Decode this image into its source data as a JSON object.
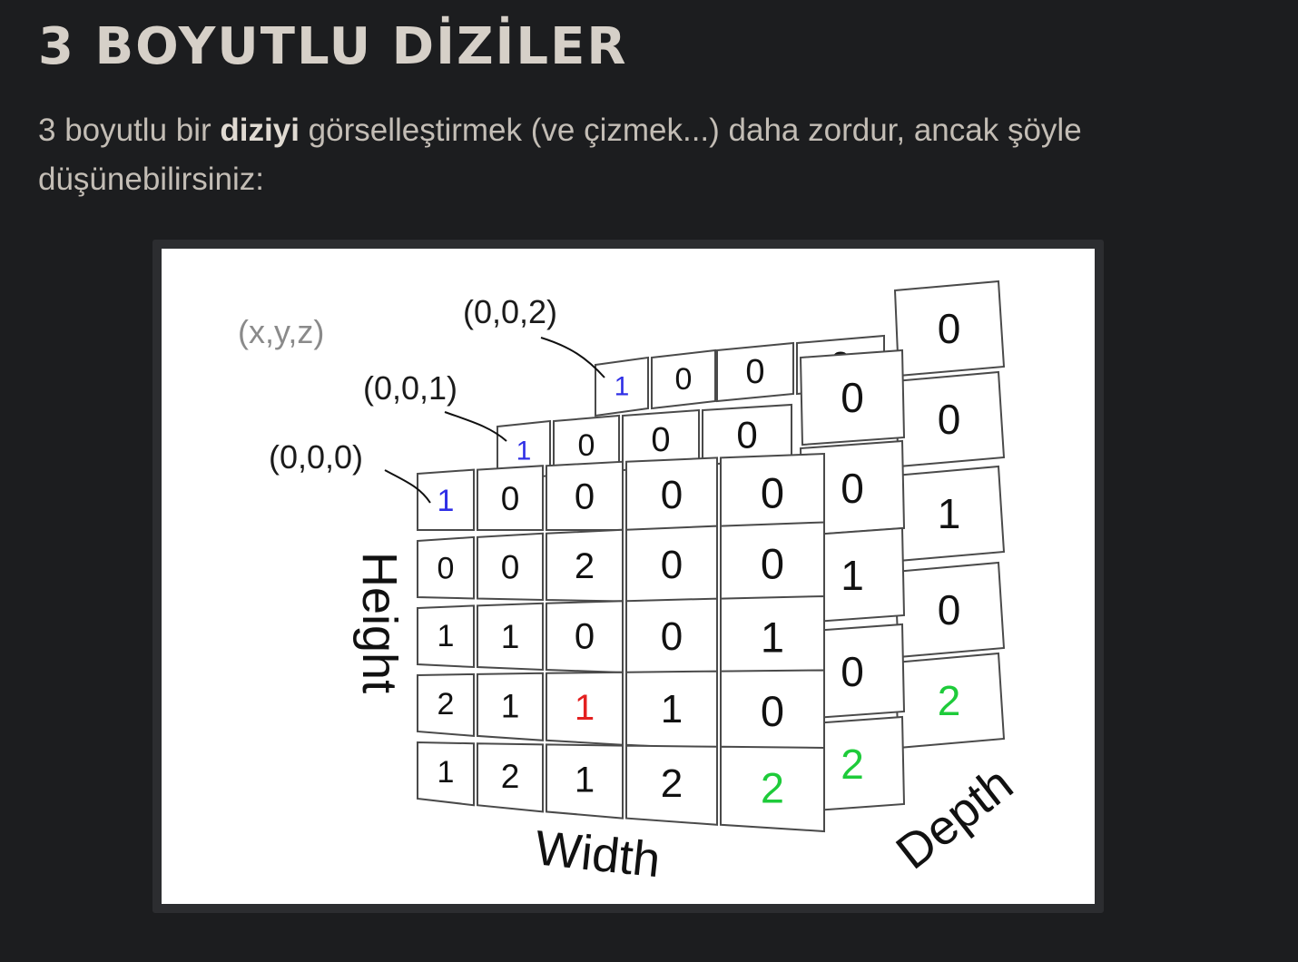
{
  "title": "3 BOYUTLU DİZİLER",
  "intro": {
    "before": "3 boyutlu bir ",
    "bold": "diziyi",
    "after": " görselleştirmek (ve çizmek...) daha zordur, ancak şöyle düşünebilirsiniz:"
  },
  "figure": {
    "legend": "(x,y,z)",
    "coord_labels": [
      "(0,0,0)",
      "(0,0,1)",
      "(0,0,2)"
    ],
    "axes": {
      "height": "Height",
      "width": "Width",
      "depth": "Depth"
    },
    "value_colors": {
      "default": "#111111",
      "blue": "#2f2fe6",
      "red": "#e32020",
      "green": "#1ecb3a"
    },
    "front_grid": [
      [
        {
          "v": "1",
          "c": "blue"
        },
        {
          "v": "0"
        },
        {
          "v": "0"
        },
        {
          "v": "0"
        },
        {
          "v": "0"
        }
      ],
      [
        {
          "v": "0"
        },
        {
          "v": "0"
        },
        {
          "v": "2"
        },
        {
          "v": "0"
        },
        {
          "v": "0"
        }
      ],
      [
        {
          "v": "1"
        },
        {
          "v": "1"
        },
        {
          "v": "0"
        },
        {
          "v": "0"
        },
        {
          "v": "1"
        }
      ],
      [
        {
          "v": "2"
        },
        {
          "v": "1"
        },
        {
          "v": "1",
          "c": "red"
        },
        {
          "v": "1"
        },
        {
          "v": "0"
        }
      ],
      [
        {
          "v": "1"
        },
        {
          "v": "2"
        },
        {
          "v": "1"
        },
        {
          "v": "2"
        },
        {
          "v": "2",
          "c": "green"
        }
      ]
    ],
    "middle_column": [
      {
        "v": "0"
      },
      {
        "v": "0"
      },
      {
        "v": "1"
      },
      {
        "v": "0"
      },
      {
        "v": "2",
        "c": "green"
      }
    ],
    "back_column": [
      {
        "v": "0"
      },
      {
        "v": "0"
      },
      {
        "v": "1"
      },
      {
        "v": "0"
      },
      {
        "v": "2",
        "c": "green"
      }
    ],
    "middle_top_row": [
      {
        "v": "1",
        "c": "blue"
      },
      {
        "v": "0"
      },
      {
        "v": "0"
      },
      {
        "v": "0"
      }
    ],
    "back_top_row": [
      {
        "v": "1",
        "c": "blue"
      },
      {
        "v": "0"
      },
      {
        "v": "0"
      },
      {
        "v": "0"
      }
    ]
  }
}
